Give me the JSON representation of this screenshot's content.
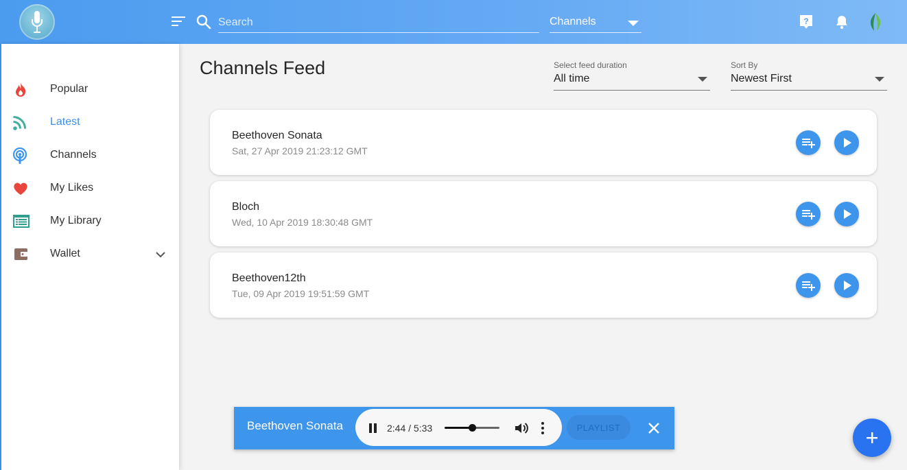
{
  "header": {
    "search_placeholder": "Search",
    "channel_select": "Channels"
  },
  "sidebar": {
    "items": [
      {
        "label": "Popular",
        "icon": "fire-icon",
        "active": false
      },
      {
        "label": "Latest",
        "icon": "rss-icon",
        "active": true
      },
      {
        "label": "Channels",
        "icon": "podcast-icon",
        "active": false
      },
      {
        "label": "My Likes",
        "icon": "heart-icon",
        "active": false
      },
      {
        "label": "My Library",
        "icon": "library-icon",
        "active": false
      },
      {
        "label": "Wallet",
        "icon": "wallet-icon",
        "active": false
      }
    ]
  },
  "main": {
    "title": "Channels Feed",
    "duration_filter": {
      "caption": "Select feed duration",
      "value": "All time"
    },
    "sort_filter": {
      "caption": "Sort By",
      "value": "Newest First"
    },
    "feed": [
      {
        "title": "Beethoven Sonata",
        "date": "Sat, 27 Apr 2019 21:23:12 GMT"
      },
      {
        "title": "Bloch",
        "date": "Wed, 10 Apr 2019 18:30:48 GMT"
      },
      {
        "title": "Beethoven12th",
        "date": "Tue, 09 Apr 2019 19:51:59 GMT"
      }
    ]
  },
  "player": {
    "track": "Beethoven Sonata",
    "time": "2:44 / 5:33",
    "volume_level": 0.5,
    "playlist_label": "PLAYLIST"
  },
  "colors": {
    "accent": "#3d95ec",
    "header_start": "#4b9bef",
    "fab": "#2a73f0",
    "active_nav": "#3d8fe0"
  }
}
